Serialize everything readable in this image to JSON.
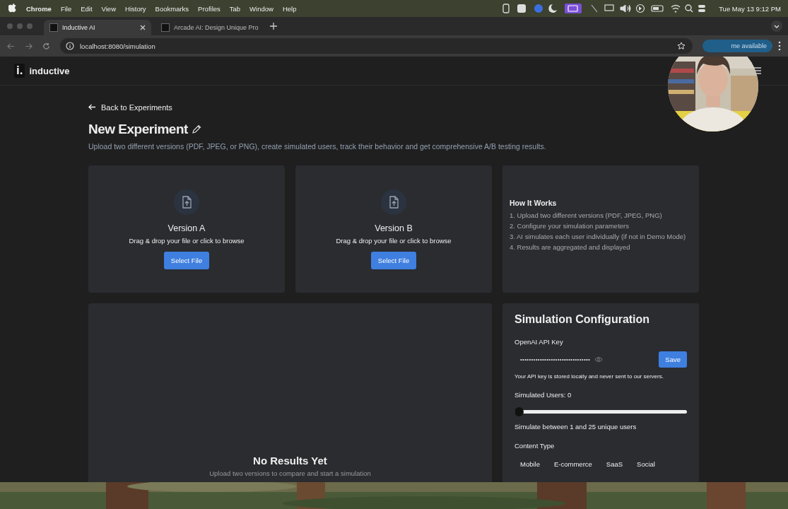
{
  "menu_bar": {
    "app": "Chrome",
    "items": [
      "File",
      "Edit",
      "View",
      "History",
      "Bookmarks",
      "Profiles",
      "Tab",
      "Window",
      "Help"
    ],
    "clock": "Tue May 13  9:12 PM"
  },
  "tabs": [
    {
      "title": "Inductive AI",
      "selected": true
    },
    {
      "title": "Arcade AI: Design Unique Pro",
      "selected": false
    }
  ],
  "address_bar": {
    "url": "localhost:8080/simulation",
    "notice": "me available"
  },
  "header": {
    "logo_mark": "i.",
    "brand": "inductive"
  },
  "back_link": "Back to Experiments",
  "title": "New Experiment",
  "subtitle": "Upload two different versions (PDF, JPEG, or PNG), create simulated users, track their behavior and get comprehensive A/B testing results.",
  "uploads": [
    {
      "title": "Version A",
      "hint": "Drag & drop your file or click to browse",
      "button": "Select File"
    },
    {
      "title": "Version B",
      "hint": "Drag & drop your file or click to browse",
      "button": "Select File"
    }
  ],
  "how_it_works": {
    "title": "How It Works",
    "steps": [
      "1. Upload two different versions (PDF, JPEG, PNG)",
      "2. Configure your simulation parameters",
      "3. AI simulates each user individually (if not in Demo Mode)",
      "4. Results are aggregated and displayed"
    ]
  },
  "results": {
    "title": "No Results Yet",
    "hint": "Upload two versions to compare and start a simulation"
  },
  "config": {
    "title": "Simulation Configuration",
    "api_label": "OpenAI API Key",
    "api_value": "••••••••••••••••••••••••••••••••",
    "save": "Save",
    "api_note": "Your API key is stored locally and never sent to our servers.",
    "users_label": "Simulated Users: 0",
    "users_slider": {
      "level": 0
    },
    "users_hint": "Simulate between 1 and 25 unique users",
    "content_label": "Content Type",
    "content_types": [
      {
        "label": "Mobile",
        "selected": false
      },
      {
        "label": "E-commerce",
        "selected": false
      },
      {
        "label": "SaaS",
        "selected": false
      },
      {
        "label": "Social",
        "selected": false
      }
    ]
  }
}
